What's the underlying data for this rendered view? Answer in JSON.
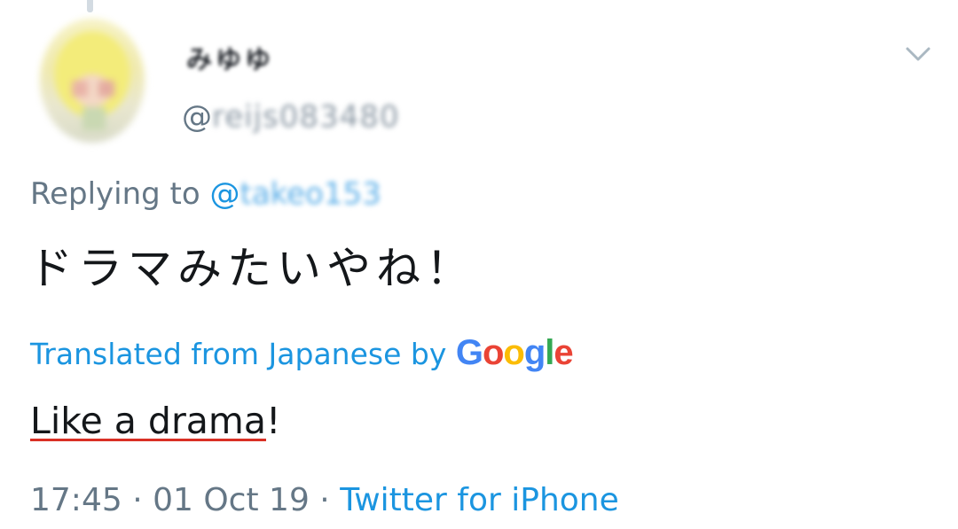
{
  "author": {
    "display_name": "みゆゆ",
    "handle_prefix": "@",
    "handle": "reijs083480"
  },
  "reply": {
    "prefix": "Replying to ",
    "mention_prefix": "@",
    "mention_handle": "takeo153"
  },
  "tweet": {
    "text": "ドラマみたいやね！"
  },
  "translation": {
    "label": "Translated from Japanese by ",
    "provider": "Google",
    "provider_letters": [
      {
        "char": "G",
        "color": "#4285F4"
      },
      {
        "char": "o",
        "color": "#EA4335"
      },
      {
        "char": "o",
        "color": "#FBBC05"
      },
      {
        "char": "g",
        "color": "#4285F4"
      },
      {
        "char": "l",
        "color": "#34A853"
      },
      {
        "char": "e",
        "color": "#EA4335"
      }
    ],
    "text_main": "Like a drama",
    "text_end": "!"
  },
  "meta": {
    "time": "17:45",
    "sep1": " · ",
    "date": "01 Oct 19",
    "sep2": " · ",
    "source": "Twitter for iPhone"
  },
  "icons": {
    "menu": "chevron-down-icon"
  },
  "colors": {
    "link": "#1b95e0",
    "secondary_text": "#657786",
    "primary_text": "#14171a",
    "spellcheck_underline": "#d93025"
  }
}
